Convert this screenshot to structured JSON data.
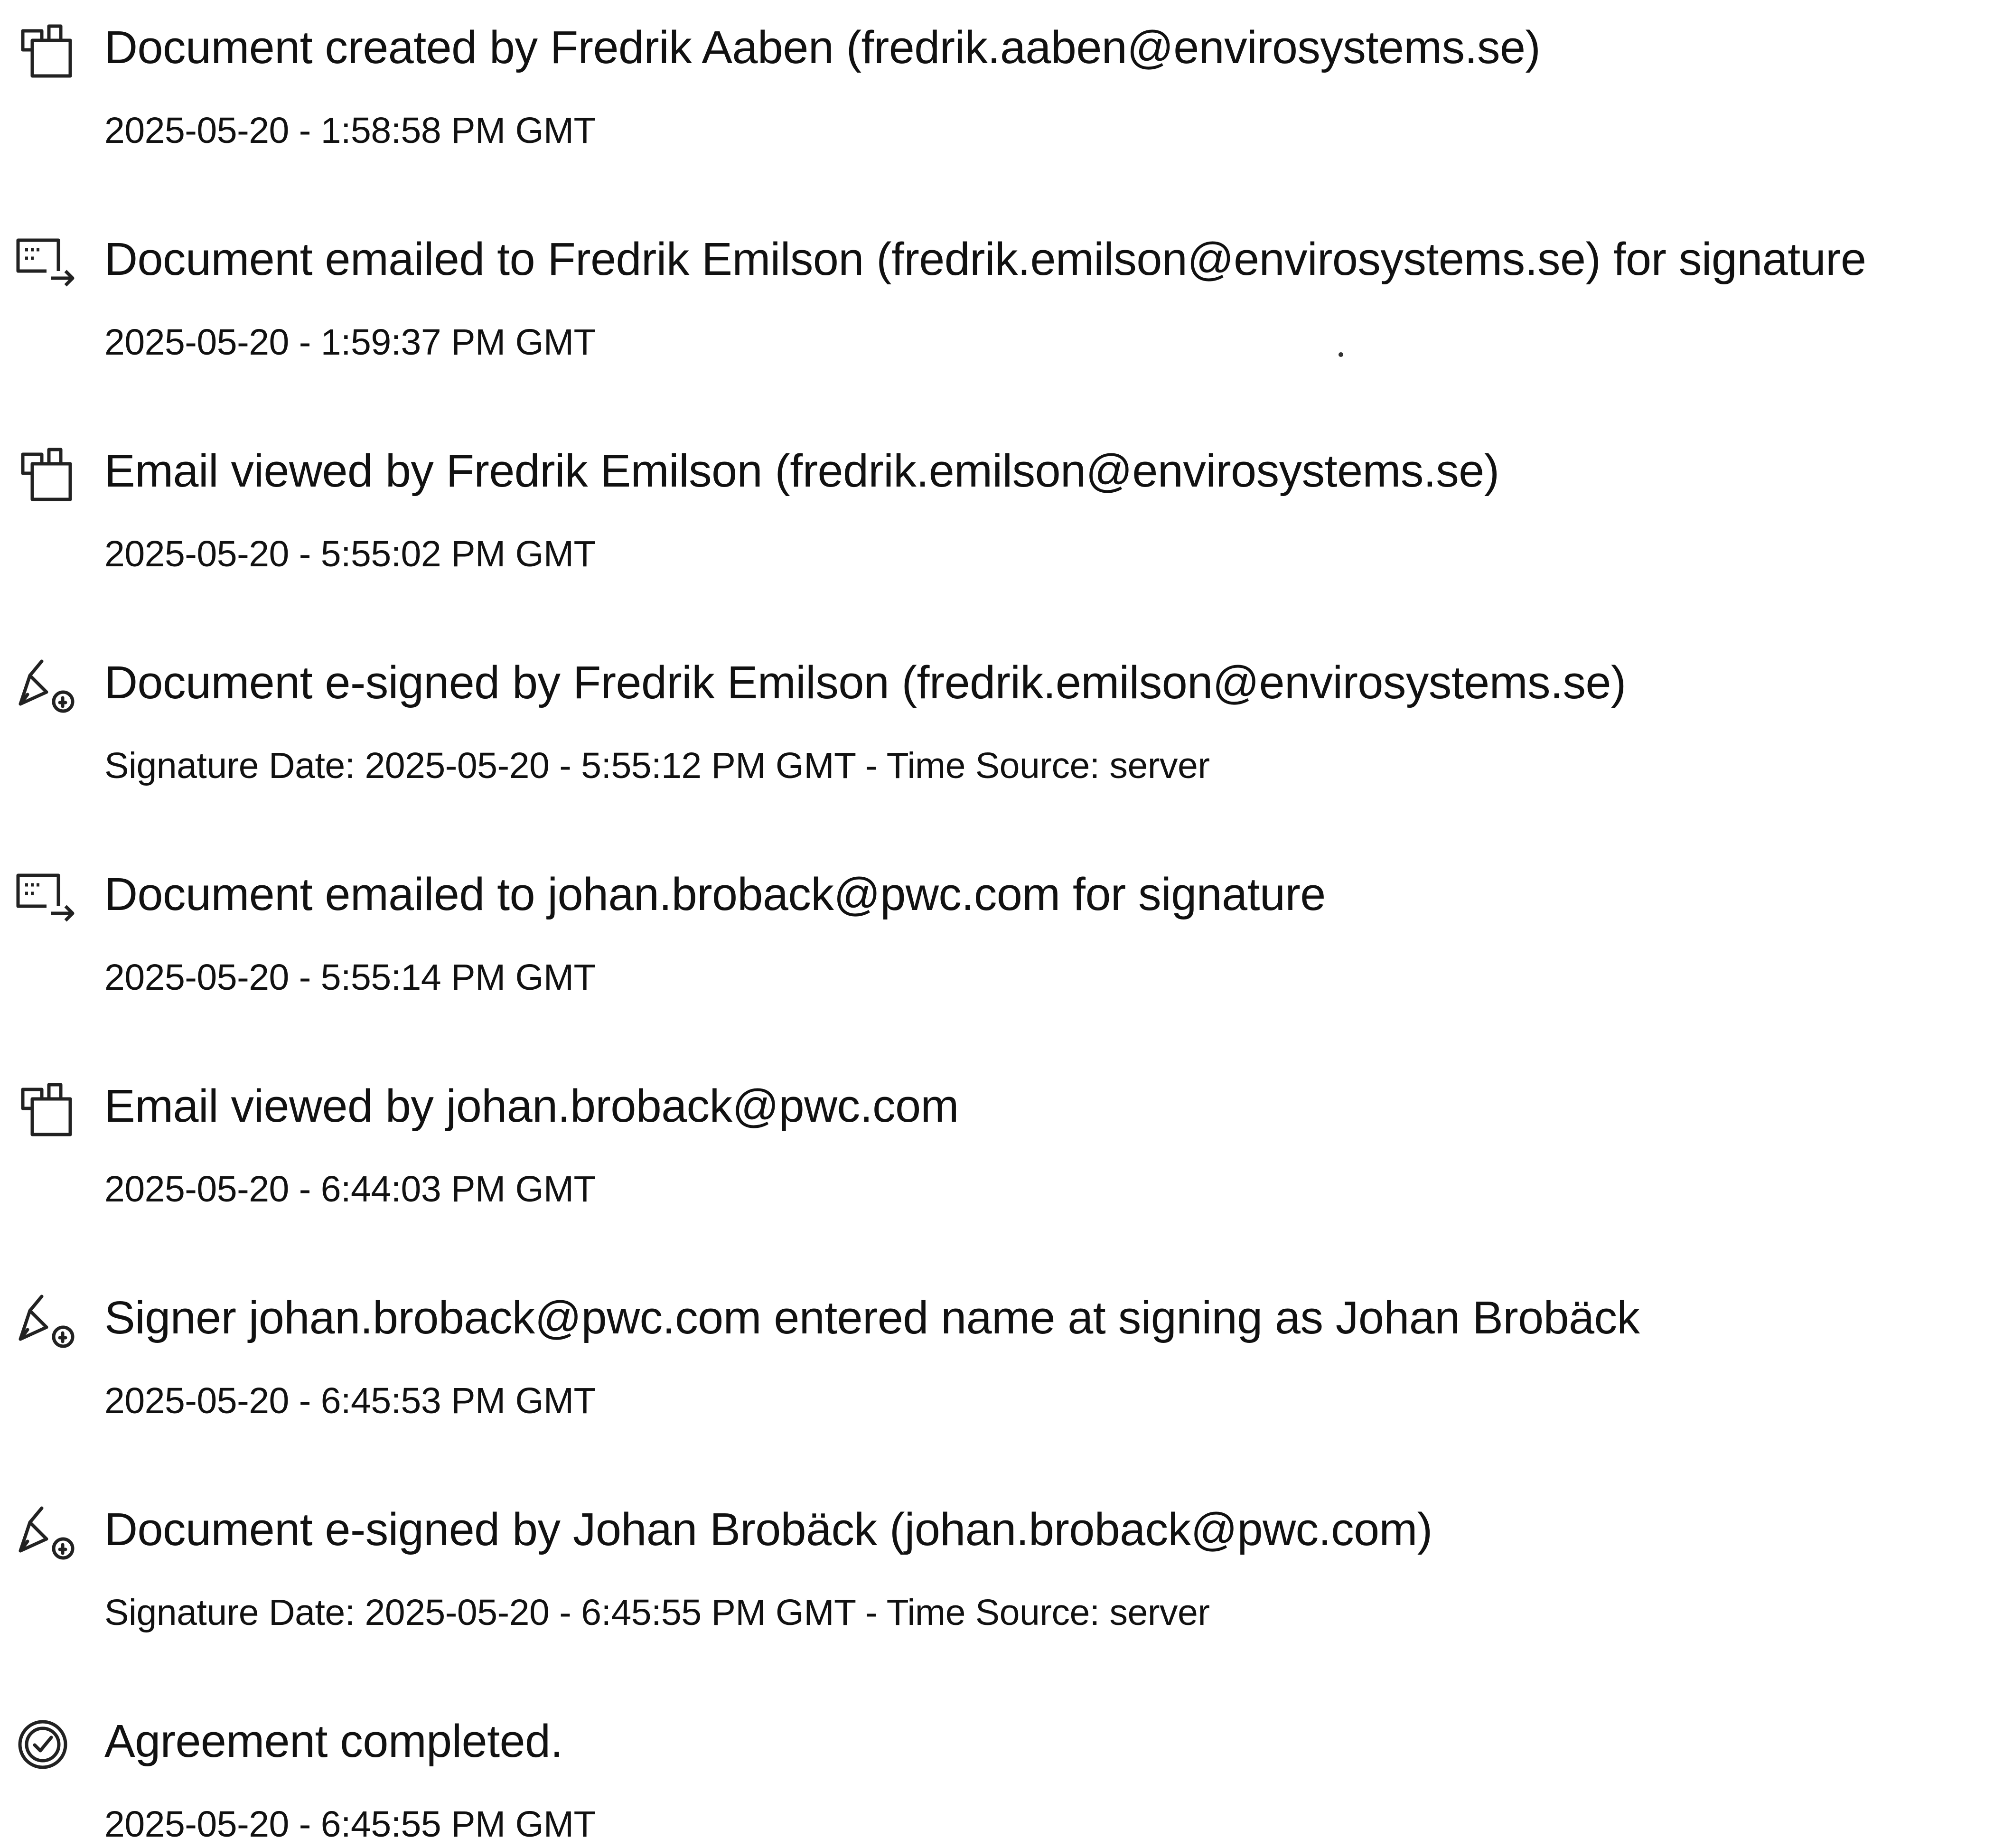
{
  "events": [
    {
      "icon": "document-created-icon",
      "title": "Document created by Fredrik Aaben (fredrik.aaben@envirosystems.se)",
      "detail": "2025-05-20 - 1:58:58 PM GMT"
    },
    {
      "icon": "document-emailed-icon",
      "title": "Document emailed to Fredrik Emilson (fredrik.emilson@envirosystems.se) for signature",
      "detail": "2025-05-20 - 1:59:37 PM GMT"
    },
    {
      "icon": "email-viewed-icon",
      "title": "Email viewed by Fredrik Emilson (fredrik.emilson@envirosystems.se)",
      "detail": "2025-05-20 - 5:55:02 PM GMT"
    },
    {
      "icon": "e-signed-icon",
      "title": "Document e-signed by Fredrik Emilson (fredrik.emilson@envirosystems.se)",
      "detail": "Signature Date: 2025-05-20 - 5:55:12 PM GMT - Time Source: server"
    },
    {
      "icon": "document-emailed-icon",
      "title": "Document emailed to johan.broback@pwc.com for signature",
      "detail": "2025-05-20 - 5:55:14 PM GMT"
    },
    {
      "icon": "email-viewed-icon",
      "title": "Email viewed by johan.broback@pwc.com",
      "detail": "2025-05-20 - 6:44:03 PM GMT"
    },
    {
      "icon": "signer-name-icon",
      "title": "Signer johan.broback@pwc.com entered name at signing as Johan Brobäck",
      "detail": "2025-05-20 - 6:45:53 PM GMT"
    },
    {
      "icon": "e-signed-icon",
      "title": "Document e-signed by Johan Brobäck (johan.broback@pwc.com)",
      "detail": "Signature Date: 2025-05-20 - 6:45:55 PM GMT - Time Source: server"
    },
    {
      "icon": "agreement-completed-icon",
      "title": "Agreement completed.",
      "detail": "2025-05-20 - 6:45:55 PM GMT"
    }
  ]
}
